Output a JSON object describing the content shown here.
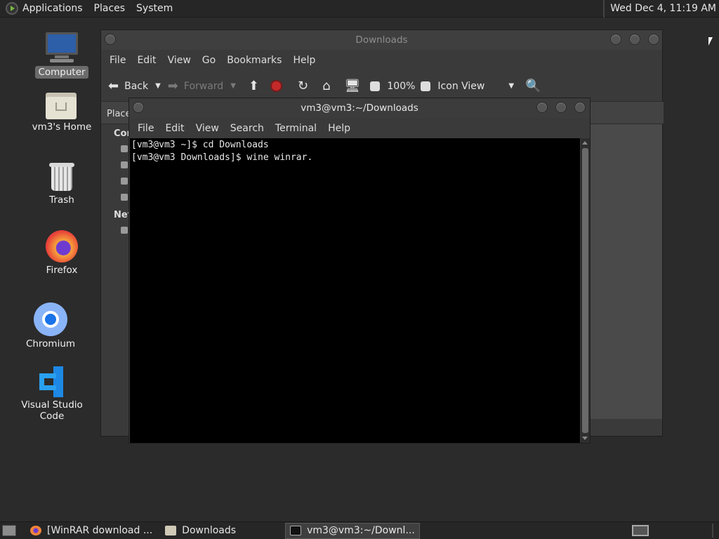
{
  "top_panel": {
    "applications": "Applications",
    "places": "Places",
    "system": "System",
    "clock": "Wed Dec  4, 11:19 AM"
  },
  "desktop": {
    "icons": [
      {
        "label": "Computer",
        "icon": "computer-icon",
        "selected": true
      },
      {
        "label": "vm3's Home",
        "icon": "home-folder-icon"
      },
      {
        "label": "Trash",
        "icon": "trash-icon"
      },
      {
        "label": "Firefox",
        "icon": "firefox-icon"
      },
      {
        "label": "Chromium",
        "icon": "chromium-icon"
      },
      {
        "label": "Visual Studio Code",
        "icon": "vscode-icon"
      }
    ]
  },
  "file_manager": {
    "title": "Downloads",
    "menu": [
      "File",
      "Edit",
      "View",
      "Go",
      "Bookmarks",
      "Help"
    ],
    "toolbar": {
      "back": "Back",
      "forward": "Forward",
      "zoom": "100%",
      "view_mode": "Icon View"
    },
    "sidebar": {
      "places_label": "Place",
      "computer_label": "Cor",
      "network_label": "Net"
    }
  },
  "terminal": {
    "title": "vm3@vm3:~/Downloads",
    "menu": [
      "File",
      "Edit",
      "View",
      "Search",
      "Terminal",
      "Help"
    ],
    "lines": [
      "[vm3@vm3 ~]$ cd Downloads",
      "[vm3@vm3 Downloads]$ wine winrar."
    ]
  },
  "taskbar": {
    "tasks": [
      {
        "label": "[WinRAR download ...",
        "icon": "firefox-icon",
        "active": false
      },
      {
        "label": "Downloads",
        "icon": "folder-icon",
        "active": false
      },
      {
        "label": "vm3@vm3:~/Downl...",
        "icon": "terminal-icon",
        "active": true
      }
    ]
  },
  "colors": {
    "desktop_bg": "#2b2b2b",
    "panel_bg": "#262626",
    "terminal_bg": "#000000",
    "selected_label_bg": "#6b6b6b"
  }
}
